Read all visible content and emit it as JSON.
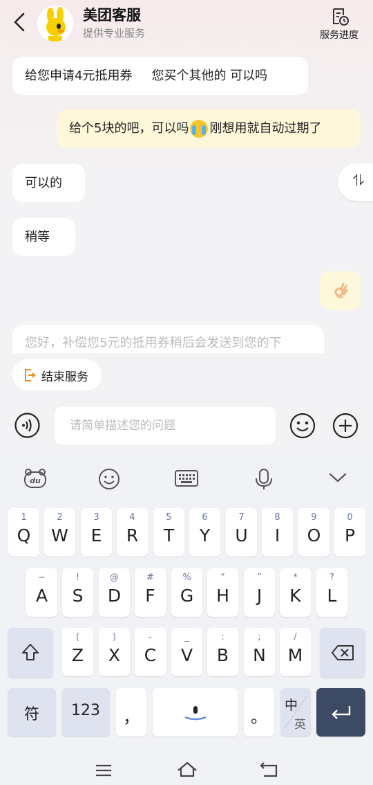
{
  "header": {
    "title": "美团客服",
    "subtitle": "提供专业服务",
    "progress_label": "服务进度"
  },
  "messages": [
    {
      "side": "left",
      "parts": [
        "给您申请4元抵用券",
        "您买个其他的 可以吗"
      ]
    },
    {
      "side": "right",
      "text_before": "给个5块的吧，可以吗",
      "emoji": "crying-face-icon",
      "text_after": "刚想用就自动过期了"
    },
    {
      "side": "left",
      "text": "可以的"
    },
    {
      "side": "left",
      "text": "稍等"
    },
    {
      "side": "right",
      "emoji": "ok-hand-icon"
    },
    {
      "side": "left",
      "text": "您好，补偿您5元的抵用券稍后会发送到您的下"
    }
  ],
  "swap_button": "⥮",
  "end_service": {
    "label": "结束服务"
  },
  "input": {
    "placeholder": "请简单描述您的问题"
  },
  "keyboard": {
    "toolbar": [
      "du-logo-icon",
      "emoji-icon",
      "keyboard-icon",
      "microphone-icon",
      "chevron-down-icon"
    ],
    "row1": [
      {
        "num": "1",
        "ltr": "Q"
      },
      {
        "num": "2",
        "ltr": "W"
      },
      {
        "num": "3",
        "ltr": "E"
      },
      {
        "num": "4",
        "ltr": "R"
      },
      {
        "num": "5",
        "ltr": "T"
      },
      {
        "num": "6",
        "ltr": "Y"
      },
      {
        "num": "7",
        "ltr": "U"
      },
      {
        "num": "8",
        "ltr": "I"
      },
      {
        "num": "9",
        "ltr": "O"
      },
      {
        "num": "0",
        "ltr": "P"
      }
    ],
    "row2": [
      {
        "num": "~",
        "ltr": "A"
      },
      {
        "num": "!",
        "ltr": "S"
      },
      {
        "num": "@",
        "ltr": "D"
      },
      {
        "num": "#",
        "ltr": "F"
      },
      {
        "num": "%",
        "ltr": "G"
      },
      {
        "num": "“",
        "ltr": "H"
      },
      {
        "num": "”",
        "ltr": "J"
      },
      {
        "num": "*",
        "ltr": "K"
      },
      {
        "num": "?",
        "ltr": "L"
      }
    ],
    "row3": [
      {
        "num": "(",
        "ltr": "Z"
      },
      {
        "num": ")",
        "ltr": "X"
      },
      {
        "num": "-",
        "ltr": "C"
      },
      {
        "num": "_",
        "ltr": "V"
      },
      {
        "num": ":",
        "ltr": "B"
      },
      {
        "num": ";",
        "ltr": "N"
      },
      {
        "num": "/",
        "ltr": "M"
      }
    ],
    "symbols_label": "符",
    "numbers_label": "123",
    "comma_label": "，",
    "period_label": "。",
    "lang_top": "中",
    "lang_bottom": "英"
  }
}
